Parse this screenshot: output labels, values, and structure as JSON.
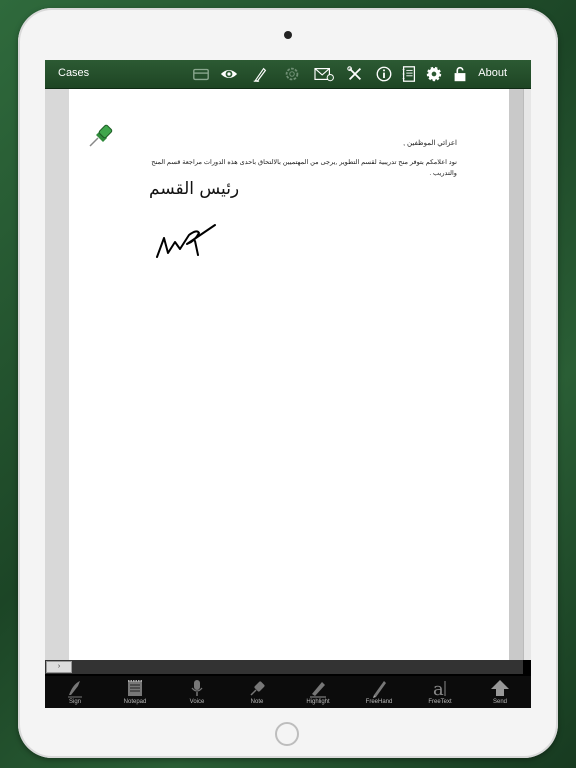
{
  "toolbar": {
    "cases_label": "Cases",
    "about_label": "About",
    "icons": [
      "card-icon",
      "eye-icon",
      "pen-icon",
      "gear-faint-icon",
      "mail-icon",
      "tools-icon",
      "info-icon",
      "notebook-icon",
      "gear-icon",
      "lock-icon"
    ]
  },
  "document": {
    "greeting": "اعزائي الموظفين ,",
    "body": "نود اعلامكم بتوفر منح تدريبية لقسم التطوير ,يرجى من المهتميين بالالتحاق باحدى هذه الدورات مراجعة قسم المنح والتدريب .",
    "signature_title": "رئيس القسم"
  },
  "bottom_tools": [
    {
      "label": "Sign",
      "icon": "sign-icon"
    },
    {
      "label": "Notepad",
      "icon": "notepad-icon"
    },
    {
      "label": "Voice",
      "icon": "microphone-icon"
    },
    {
      "label": "Note",
      "icon": "note-pin-icon"
    },
    {
      "label": "Highlight",
      "icon": "highlighter-icon"
    },
    {
      "label": "FreeHand",
      "icon": "pencil-icon"
    },
    {
      "label": "FreeText",
      "icon": "text-a-icon"
    },
    {
      "label": "Send",
      "icon": "send-arrow-icon"
    }
  ],
  "colors": {
    "toolbar": "#2c5a33",
    "bottombar": "#0c0c0c",
    "background": "#1f4a2a"
  }
}
